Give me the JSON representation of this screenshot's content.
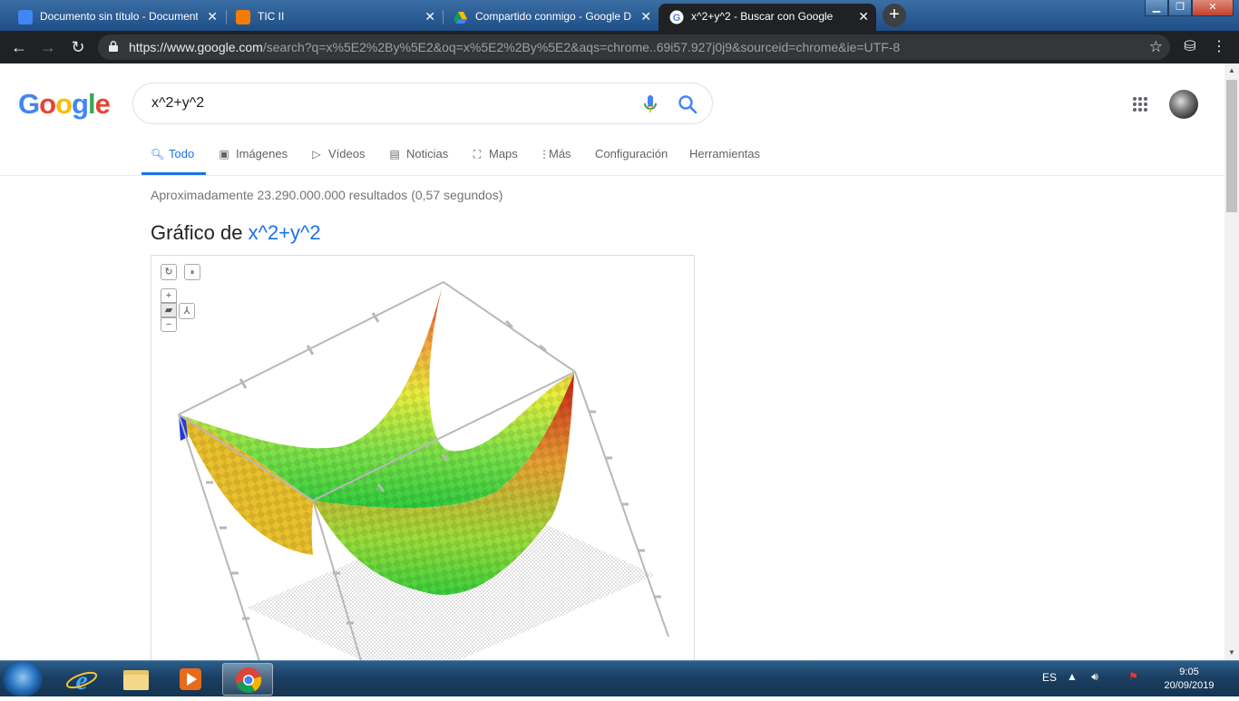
{
  "browser": {
    "tabs": [
      {
        "title": "Documento sin título - Documentos de Google",
        "favicon": "docs-icon",
        "color": "#4285f4",
        "active": false
      },
      {
        "title": "TIC II",
        "favicon": "blogger-icon",
        "color": "#f57c00",
        "active": false
      },
      {
        "title": "Compartido conmigo - Google Drive",
        "favicon": "drive-icon",
        "color": "#0f9d58",
        "active": false
      },
      {
        "title": "x^2+y^2 - Buscar con Google",
        "favicon": "google-icon",
        "color": "#4285f4",
        "active": true
      }
    ],
    "new_tab": "+",
    "url_host": "https://www.google.com",
    "url_rest": "/search?q=x%5E2%2By%5E2&oq=x%5E2%2By%5E2&aqs=chrome..69i57.927j0j9&sourceid=chrome&ie=UTF-8",
    "window_controls": [
      "minimize",
      "maximize",
      "close"
    ]
  },
  "google": {
    "logo": "Google",
    "query": "x^2+y^2",
    "tabs": [
      {
        "label": "Todo",
        "icon": "search-icon",
        "active": true
      },
      {
        "label": "Imágenes",
        "icon": "image-icon",
        "active": false
      },
      {
        "label": "Vídeos",
        "icon": "video-icon",
        "active": false
      },
      {
        "label": "Noticias",
        "icon": "news-icon",
        "active": false
      },
      {
        "label": "Maps",
        "icon": "map-icon",
        "active": false
      },
      {
        "label": "Más",
        "icon": "more-icon",
        "active": false
      },
      {
        "label": "Configuración",
        "icon": "",
        "active": false
      },
      {
        "label": "Herramientas",
        "icon": "",
        "active": false
      }
    ],
    "stats": "Aproximadamente 23.290.000.000 resultados (0,57 segundos)",
    "graph_title_prefix": "Gráfico de",
    "graph_title_expr": "x^2+y^2"
  },
  "graph_controls": {
    "reset": "↻",
    "pause": "⏸",
    "zoom_in": "+",
    "camera": "camera-icon",
    "axes": "axes-icon",
    "zoom_out": "−"
  },
  "taskbar": {
    "apps": [
      "internet-explorer-icon",
      "file-explorer-icon",
      "media-player-icon",
      "chrome-icon"
    ],
    "lang": "ES",
    "time": "9:05",
    "date": "20/09/2019"
  }
}
